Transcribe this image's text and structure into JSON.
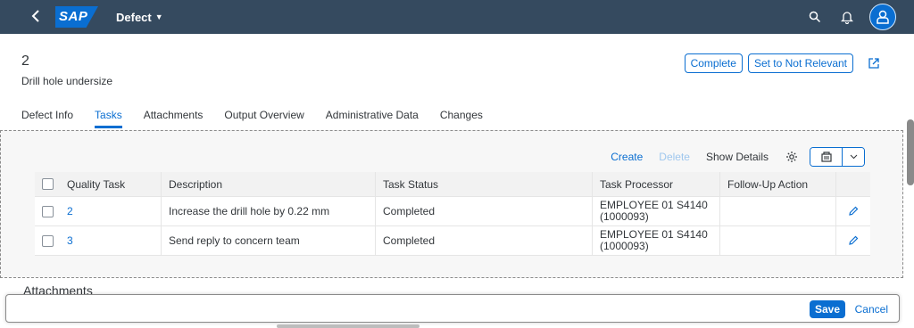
{
  "shell": {
    "logo": "SAP",
    "title": "Defect",
    "icons": [
      "back-icon",
      "search-icon",
      "bell-icon",
      "user-icon"
    ],
    "brand_color": "#354a5f",
    "accent_color": "#0a6ed1"
  },
  "header": {
    "id": "2",
    "subtitle": "Drill hole undersize",
    "actions": {
      "complete": "Complete",
      "not_relevant": "Set to Not Relevant"
    }
  },
  "tabs": [
    {
      "label": "Defect Info",
      "active": false
    },
    {
      "label": "Tasks",
      "active": true
    },
    {
      "label": "Attachments",
      "active": false
    },
    {
      "label": "Output Overview",
      "active": false
    },
    {
      "label": "Administrative Data",
      "active": false
    },
    {
      "label": "Changes",
      "active": false
    }
  ],
  "toolbar": {
    "create": "Create",
    "delete": "Delete",
    "show_details": "Show Details"
  },
  "table": {
    "columns": [
      "Quality Task",
      "Description",
      "Task Status",
      "Task Processor",
      "Follow-Up Action"
    ],
    "rows": [
      {
        "task": "2",
        "description": "Increase the drill hole by 0.22 mm",
        "status": "Completed",
        "processor_line1": "EMPLOYEE 01 S4140",
        "processor_line2": "(1000093)",
        "follow_up": ""
      },
      {
        "task": "3",
        "description": "Send reply to concern team",
        "status": "Completed",
        "processor_line1": "EMPLOYEE 01 S4140",
        "processor_line2": "(1000093)",
        "follow_up": ""
      }
    ]
  },
  "next_section": "Attachments",
  "footer": {
    "save": "Save",
    "cancel": "Cancel"
  }
}
